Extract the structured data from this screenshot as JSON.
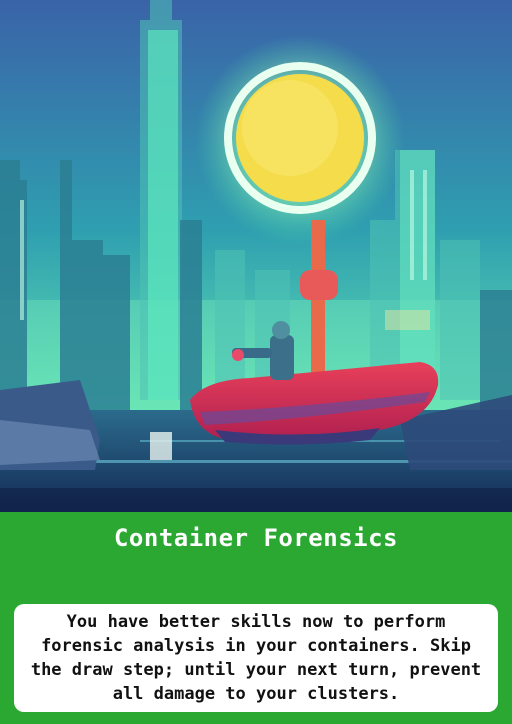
{
  "card": {
    "title": "Container Forensics",
    "description": "You have better skills now to perform forensic analysis in your containers. Skip the draw step; until your next turn, prevent all damage to your clusters."
  },
  "colors": {
    "card_background": "#2aa832",
    "title_text": "#ffffff",
    "text_box_background": "#ffffff",
    "description_text": "#111111"
  },
  "art": {
    "icon": "cyberpunk-city-boat-illustration"
  }
}
